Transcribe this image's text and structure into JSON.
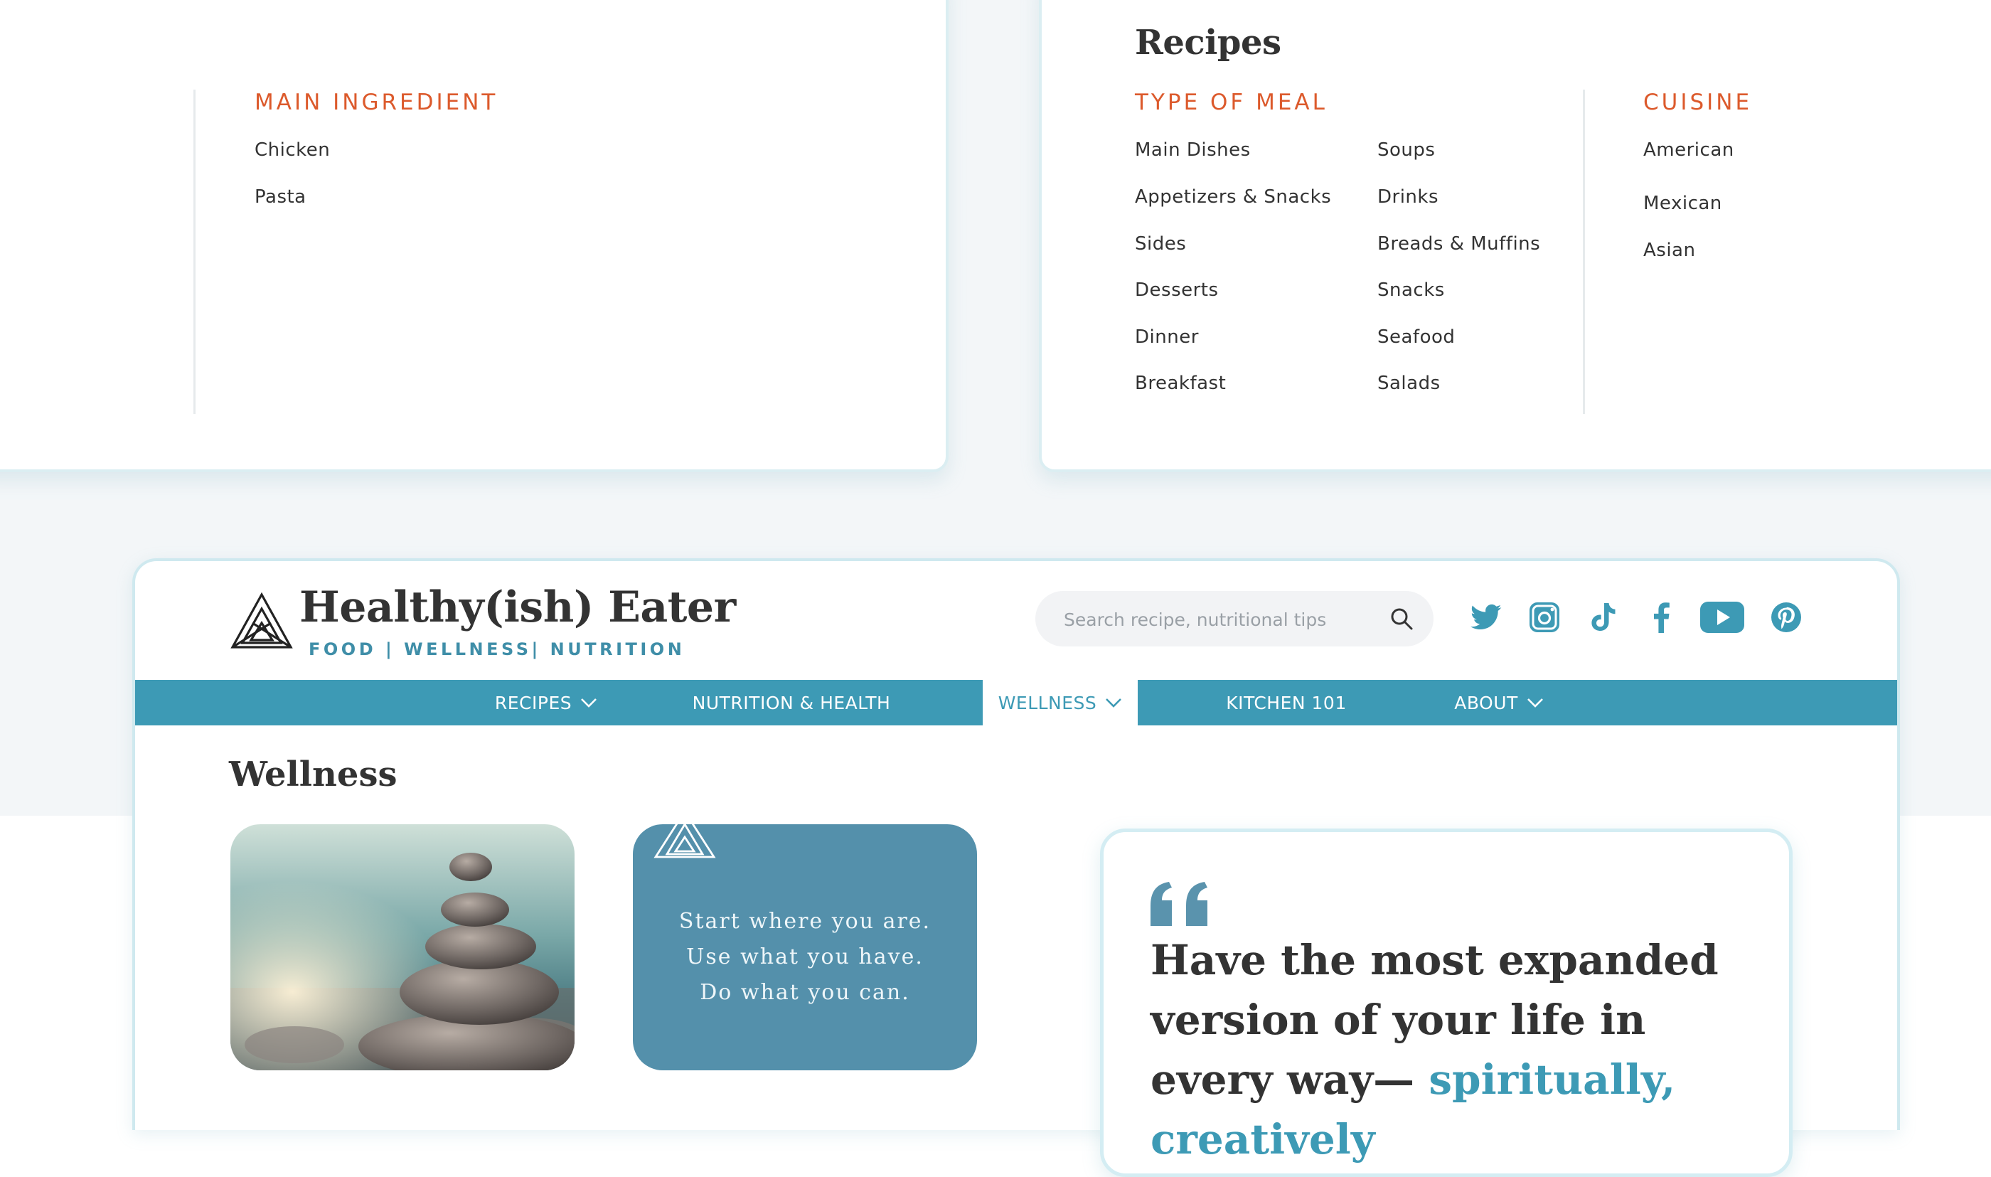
{
  "recipes_menu": {
    "title": "Recipes",
    "main_ingredient": {
      "heading": "MAIN INGREDIENT",
      "items": [
        "Chicken",
        "Pasta"
      ]
    },
    "type_of_meal": {
      "heading": "TYPE OF MEAL",
      "col1": [
        "Main Dishes",
        "Appetizers & Snacks",
        "Sides",
        "Desserts",
        "Dinner",
        "Breakfast"
      ],
      "col2": [
        "Soups",
        "Drinks",
        "Breads & Muffins",
        "Snacks",
        "Seafood",
        "Salads"
      ]
    },
    "cuisine": {
      "heading": "CUISINE",
      "items": [
        "American",
        "Mexican",
        "Asian"
      ]
    }
  },
  "site": {
    "brand": {
      "name": "Healthy(ish) Eater",
      "tagline": "FOOD | WELLNESS| NUTRITION",
      "logo_icon": "triangle-logo-icon"
    },
    "search": {
      "placeholder": "Search recipe, nutritional tips",
      "value": ""
    },
    "social": [
      "twitter-icon",
      "instagram-icon",
      "tiktok-icon",
      "facebook-icon",
      "youtube-icon",
      "pinterest-icon"
    ],
    "nav": {
      "recipes": "RECIPES",
      "nutrition": "NUTRITION & HEALTH",
      "wellness": "WELLNESS",
      "kitchen": "KITCHEN 101",
      "about": "ABOUT"
    },
    "page_title": "Wellness",
    "tile_quote": [
      "Start where you are.",
      "Use what you have.",
      "Do what you can."
    ],
    "quote": {
      "text": "Have the most expanded version of your life in every way—",
      "accent": "spiritually, creatively"
    }
  },
  "colors": {
    "accent_orange": "#dc5a2c",
    "brand_teal": "#3d9ab5",
    "tile_blue": "#5490ab",
    "text_dark": "#333333"
  }
}
